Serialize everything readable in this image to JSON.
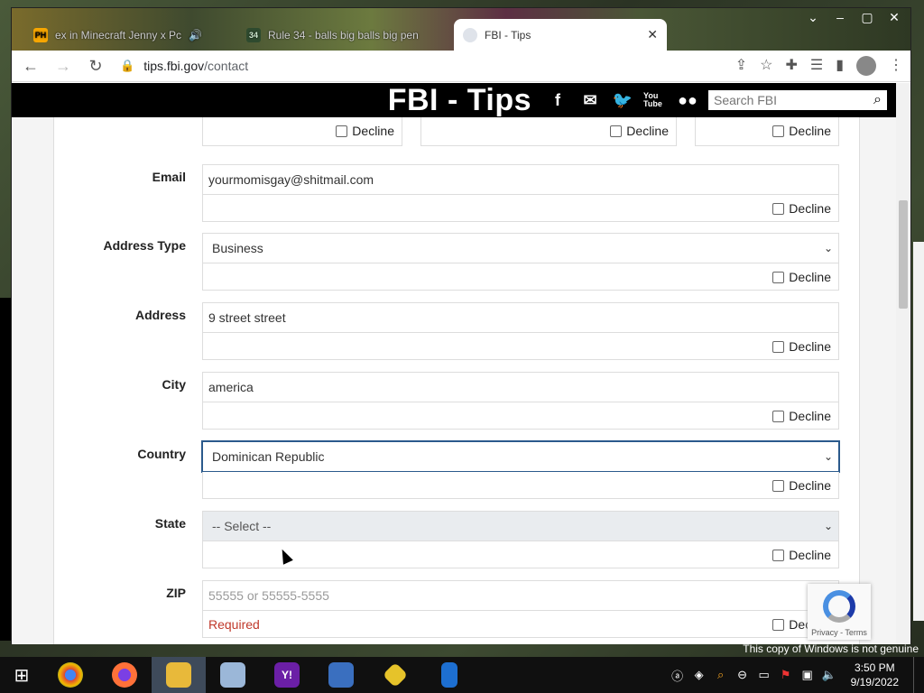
{
  "browser": {
    "tabs": [
      {
        "label": "ex in Minecraft Jenny x Pc",
        "favicon": "PH",
        "active": false
      },
      {
        "label": "Rule 34 - balls big balls big pen",
        "favicon": "34",
        "active": false
      },
      {
        "label": "FBI - Tips",
        "favicon": "fbi-seal-icon",
        "active": true
      }
    ],
    "url_host": "tips.fbi.gov",
    "url_path": "/contact"
  },
  "header": {
    "title": "FBI - Tips",
    "social": [
      "facebook-icon",
      "email-icon",
      "twitter-icon",
      "youtube-icon",
      "flickr-icon"
    ],
    "youtube_label": "You Tube",
    "search_placeholder": "Search FBI"
  },
  "form": {
    "decline_label": "Decline",
    "fields": {
      "email": {
        "label": "Email",
        "value": "yourmomisgay@shitmail.com"
      },
      "address_type": {
        "label": "Address Type",
        "value": "Business"
      },
      "address": {
        "label": "Address",
        "value": "9 street street"
      },
      "city": {
        "label": "City",
        "value": "america"
      },
      "country": {
        "label": "Country",
        "value": "Dominican Republic"
      },
      "state": {
        "label": "State",
        "value": "-- Select --"
      },
      "zip": {
        "label": "ZIP",
        "placeholder": "55555 or 55555-5555",
        "error": "Required"
      }
    }
  },
  "recaptcha": {
    "text": "Privacy - Terms"
  },
  "os": {
    "watermark": "This copy of Windows is not genuine",
    "time": "3:50 PM",
    "date": "9/19/2022"
  }
}
